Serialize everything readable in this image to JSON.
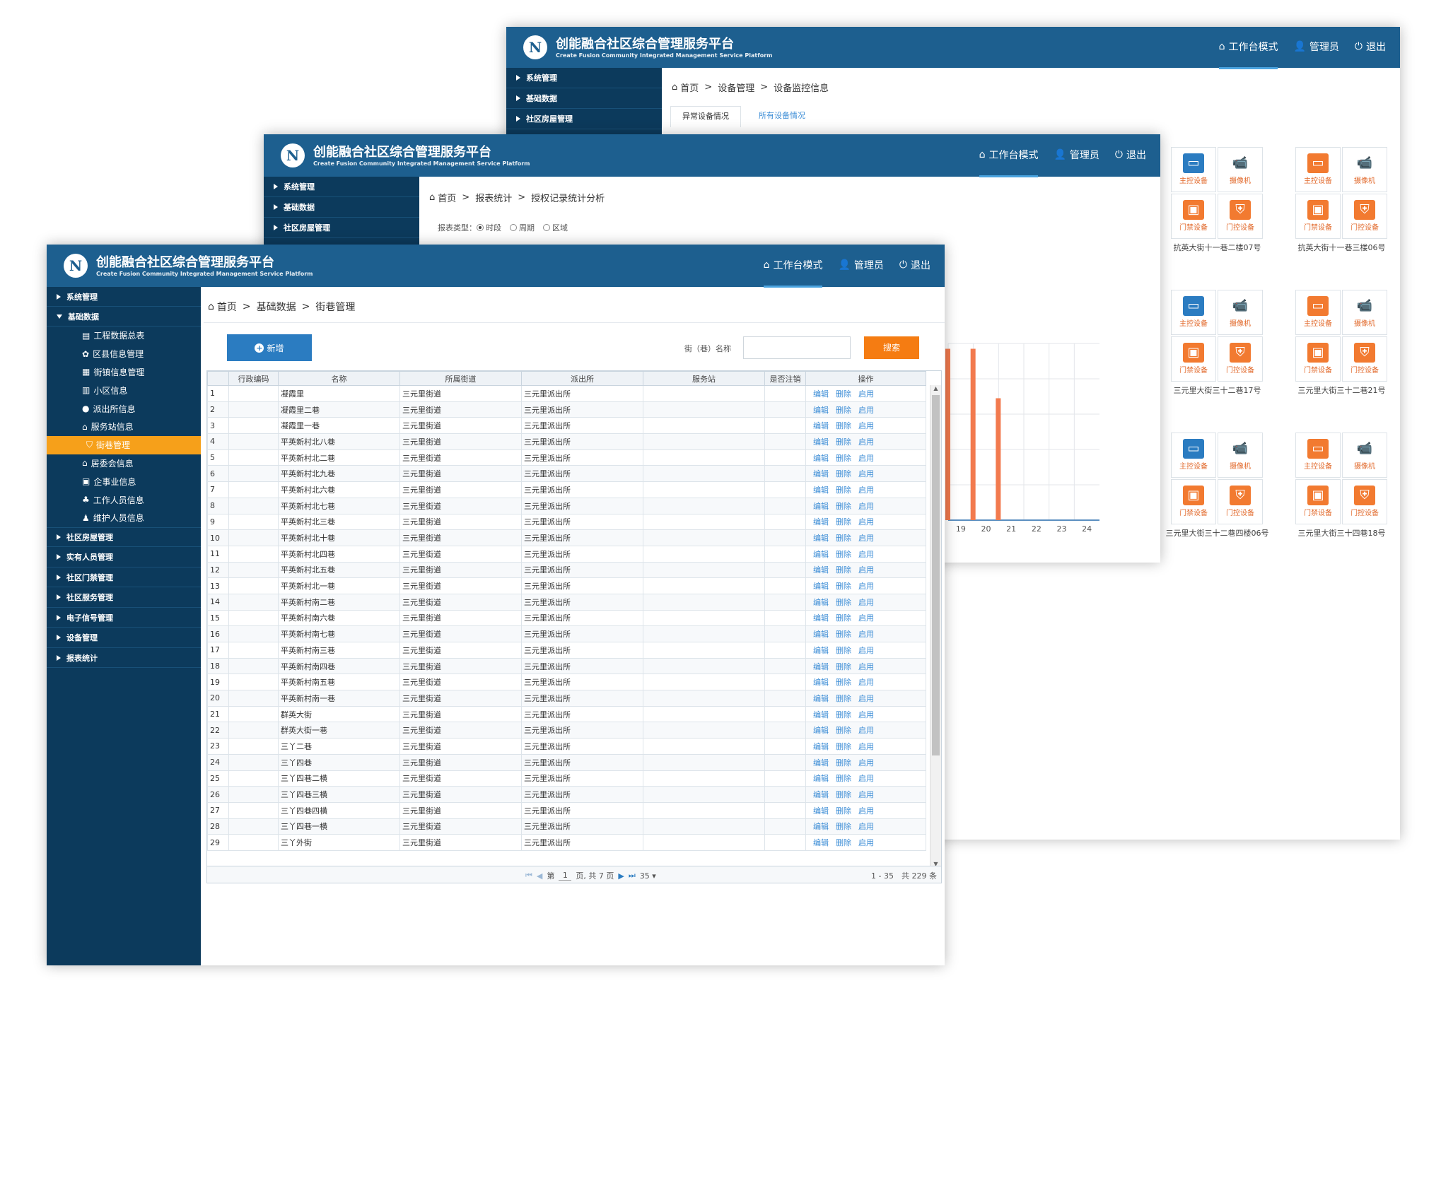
{
  "app": {
    "title_cn": "创能融合社区综合管理服务平台",
    "title_en": "Create Fusion Community Integrated Management Service Platform",
    "nav": {
      "workbench": "工作台模式",
      "admin": "管理员",
      "logout": "退出"
    }
  },
  "win_back": {
    "sidebar": [
      "系统管理",
      "基础数据",
      "社区房屋管理"
    ],
    "breadcrumb": [
      "首页",
      "设备管理",
      "设备监控信息"
    ],
    "tabs": [
      "异常设备情况",
      "所有设备情况"
    ],
    "device_types": {
      "main": "主控设备",
      "camera": "摄像机",
      "door": "门禁设备",
      "gate": "门控设备"
    },
    "groups": [
      "抗英大街十一巷二楼07号",
      "抗英大街十一巷三楼06号",
      "三元里大街三十二巷17号",
      "三元里大街三十二巷21号",
      "三元里大街三十二巷四楼06号",
      "三元里大街三十四巷18号"
    ]
  },
  "win_mid": {
    "sidebar": [
      "系统管理",
      "基础数据",
      "社区房屋管理"
    ],
    "breadcrumb": [
      "首页",
      "报表统计",
      "授权记录统计分析"
    ],
    "report_type_label": "报表类型：",
    "report_types": [
      "时段",
      "周期",
      "区域"
    ],
    "chart_data": {
      "type": "bar",
      "x": [
        19,
        20,
        21,
        22,
        23,
        24
      ],
      "values": [
        0.97,
        0.97,
        0.69,
        0,
        0,
        0
      ],
      "visible_x_range": [
        18.5,
        24.5
      ],
      "axis_tick_labels": [
        "19",
        "20",
        "21",
        "22",
        "23",
        "24"
      ],
      "bar_color": "#f27a4e",
      "grid": true
    }
  },
  "win_front": {
    "sidebar": {
      "items": [
        "系统管理",
        "基础数据",
        "社区房屋管理",
        "实有人员管理",
        "社区门禁管理",
        "社区服务管理",
        "电子信号管理",
        "设备管理",
        "报表统计"
      ],
      "sub_items": [
        "工程数据总表",
        "区县信息管理",
        "街镇信息管理",
        "小区信息",
        "派出所信息",
        "服务站信息",
        "街巷管理",
        "居委会信息",
        "企事业信息",
        "工作人员信息",
        "维护人员信息"
      ],
      "selected_sub": "街巷管理"
    },
    "breadcrumb": [
      "首页",
      "基础数据",
      "街巷管理"
    ],
    "add_button": "新增",
    "search_label": "街（巷）名称",
    "search_value": "",
    "search_button": "搜索",
    "table": {
      "columns": [
        "",
        "行政编码",
        "名称",
        "所属街道",
        "派出所",
        "服务站",
        "是否注销",
        "操作"
      ],
      "ops": [
        "编辑",
        "删除",
        "启用"
      ],
      "street": "三元里街道",
      "police": "三元里派出所",
      "rows": [
        {
          "no": "1",
          "name": "凝霞里"
        },
        {
          "no": "2",
          "name": "凝霞里二巷"
        },
        {
          "no": "3",
          "name": "凝霞里一巷"
        },
        {
          "no": "4",
          "name": "平英新村北八巷"
        },
        {
          "no": "5",
          "name": "平英新村北二巷"
        },
        {
          "no": "6",
          "name": "平英新村北九巷"
        },
        {
          "no": "7",
          "name": "平英新村北六巷"
        },
        {
          "no": "8",
          "name": "平英新村北七巷"
        },
        {
          "no": "9",
          "name": "平英新村北三巷"
        },
        {
          "no": "10",
          "name": "平英新村北十巷"
        },
        {
          "no": "11",
          "name": "平英新村北四巷"
        },
        {
          "no": "12",
          "name": "平英新村北五巷"
        },
        {
          "no": "13",
          "name": "平英新村北一巷"
        },
        {
          "no": "14",
          "name": "平英新村南二巷"
        },
        {
          "no": "15",
          "name": "平英新村南六巷"
        },
        {
          "no": "16",
          "name": "平英新村南七巷"
        },
        {
          "no": "17",
          "name": "平英新村南三巷"
        },
        {
          "no": "18",
          "name": "平英新村南四巷"
        },
        {
          "no": "19",
          "name": "平英新村南五巷"
        },
        {
          "no": "20",
          "name": "平英新村南一巷"
        },
        {
          "no": "21",
          "name": "群英大街"
        },
        {
          "no": "22",
          "name": "群英大街一巷"
        },
        {
          "no": "23",
          "name": "三丫二巷"
        },
        {
          "no": "24",
          "name": "三丫四巷"
        },
        {
          "no": "25",
          "name": "三丫四巷二横"
        },
        {
          "no": "26",
          "name": "三丫四巷三横"
        },
        {
          "no": "27",
          "name": "三丫四巷四横"
        },
        {
          "no": "28",
          "name": "三丫四巷一横"
        },
        {
          "no": "29",
          "name": "三丫外街"
        }
      ]
    },
    "pager": {
      "prefix": "第",
      "page": "1",
      "suffix": "页, 共 7 页",
      "page_size": "35",
      "summary": "1 - 35　共 229 条"
    }
  },
  "colors": {
    "header": "#1d5f8f",
    "sidebar": "#0c3a5c",
    "accent": "#f6a01a",
    "search": "#f57c12",
    "add": "#2b7cc1",
    "link": "#3c8dd6"
  }
}
